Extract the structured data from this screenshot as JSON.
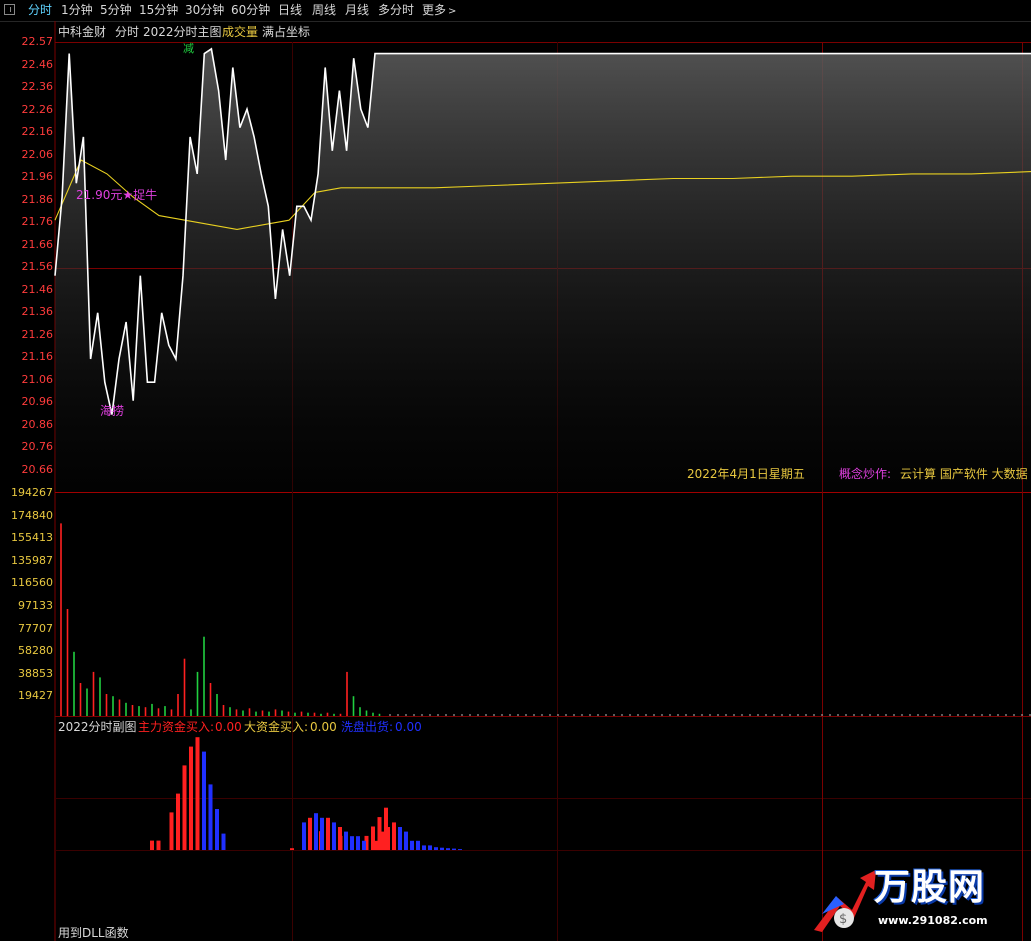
{
  "tabs": [
    "分时",
    "1分钟",
    "5分钟",
    "15分钟",
    "30分钟",
    "60分钟",
    "日线",
    "周线",
    "月线",
    "多分时",
    "更多"
  ],
  "header": {
    "stock_name": "中科金财",
    "mode": "分时",
    "formula": "2022分时主图",
    "volume_label": "成交量",
    "coord_mode": "满占坐标"
  },
  "price_axis": [
    "22.57",
    "22.46",
    "22.36",
    "22.26",
    "22.16",
    "22.06",
    "21.96",
    "21.86",
    "21.76",
    "21.66",
    "21.56",
    "21.46",
    "21.36",
    "21.26",
    "21.16",
    "21.06",
    "20.96",
    "20.86",
    "20.76",
    "20.66"
  ],
  "volume_axis": [
    "194267",
    "174840",
    "155413",
    "135987",
    "116560",
    "97133",
    "77707",
    "58280",
    "38853",
    "19427"
  ],
  "annotations": {
    "sell_marker": "减",
    "buy_marker": "海捞",
    "price_tag": "21.90元★捉牛"
  },
  "info_bar": {
    "date": "2022年4月1日星期五",
    "concept_label": "概念炒作:",
    "concepts": "云计算 国产软件 大数据 数"
  },
  "sub_panel": {
    "title": "2022分时副图",
    "main_inflow_label": "主力资金买入:",
    "main_inflow_value": "0.00",
    "big_inflow_label": "大资金买入:",
    "big_inflow_value": "0.00",
    "wash_label": "洗盘出货:",
    "wash_value": "0.00"
  },
  "footer": {
    "dll_notice": "用到DLL函数"
  },
  "watermark": {
    "brand": "万股网",
    "url": "www.291082.com"
  },
  "colors": {
    "price_line": "#ffffff",
    "avg_line": "#e8d020",
    "grid": "#7a0000",
    "up": "#ff2020",
    "down": "#20d040",
    "blue": "#2030ff",
    "magenta": "#e040e0",
    "active_tab": "#5fd3ff"
  },
  "chart_data": [
    {
      "type": "line",
      "title": "中科金财 分时",
      "ylim": [
        20.66,
        22.57
      ],
      "series": [
        {
          "name": "price",
          "values": [
            21.56,
            21.9,
            22.52,
            21.96,
            22.16,
            21.2,
            21.4,
            21.1,
            20.96,
            21.2,
            21.36,
            21.02,
            21.56,
            21.1,
            21.1,
            21.4,
            21.26,
            21.2,
            21.56,
            22.16,
            22.0,
            22.52,
            22.54,
            22.36,
            22.06,
            22.46,
            22.2,
            22.28,
            22.16,
            22.0,
            21.86,
            21.46,
            21.76,
            21.56,
            21.86,
            21.86,
            21.8,
            22.0,
            22.46,
            22.1,
            22.36,
            22.1,
            22.5,
            22.28,
            22.2,
            22.52,
            22.52
          ]
        },
        {
          "name": "avg",
          "values": [
            21.8,
            22.06,
            22.0,
            21.9,
            21.82,
            21.8,
            21.78,
            21.76,
            21.78,
            21.8,
            21.92,
            21.94,
            21.94,
            21.94,
            21.95,
            21.96,
            21.97,
            21.98,
            21.98,
            21.99,
            21.99,
            22.0,
            22.0,
            22.01
          ]
        }
      ]
    },
    {
      "type": "bar",
      "title": "成交量",
      "ylim": [
        0,
        194267
      ],
      "values": [
        174840,
        97133,
        58280,
        30000,
        25000,
        40000,
        35000,
        20000,
        18000,
        15000,
        12000,
        10000,
        9000,
        8000,
        11000,
        7000,
        9000,
        6000,
        20000,
        52000,
        6000,
        40000,
        72000,
        30000,
        20000,
        10000,
        8000,
        6000,
        5000,
        7000,
        4000,
        5000,
        4000,
        6000,
        5000,
        4000,
        3000,
        4000,
        3000,
        3000,
        2000,
        3000,
        2000,
        2000,
        40000,
        18000,
        8000,
        5000,
        3000,
        2000
      ],
      "colors": [
        "up",
        "up",
        "down",
        "up",
        "down",
        "up",
        "down",
        "up",
        "down",
        "up",
        "down",
        "up",
        "down",
        "up",
        "down",
        "up",
        "down",
        "up",
        "up",
        "up",
        "down",
        "down",
        "down",
        "up",
        "down",
        "up",
        "down",
        "up",
        "down",
        "up",
        "down",
        "up",
        "down",
        "up",
        "down",
        "up",
        "down",
        "up",
        "down",
        "up",
        "down",
        "up",
        "down",
        "up",
        "up",
        "down",
        "down",
        "down",
        "down",
        "down"
      ]
    },
    {
      "type": "bar",
      "title": "2022分时副图",
      "series": [
        {
          "name": "主力资金买入",
          "values": [
            2,
            2,
            0,
            8,
            12,
            18,
            22,
            24,
            0,
            0,
            0,
            0,
            0,
            0,
            0,
            0,
            0,
            0,
            0,
            0,
            0,
            0,
            0,
            0,
            0,
            0,
            4,
            0,
            5,
            3,
            0,
            0,
            0,
            3,
            5,
            7,
            9,
            0,
            0,
            0,
            0,
            0,
            0,
            0,
            0,
            0,
            0,
            0
          ]
        },
        {
          "name": "洗盘出货",
          "values": [
            0,
            0,
            0,
            0,
            0,
            0,
            0,
            0,
            24,
            16,
            10,
            4,
            0,
            0,
            0,
            0,
            0,
            0,
            0,
            0,
            0,
            0,
            0,
            0,
            0,
            0,
            0,
            0,
            0,
            0,
            0,
            0,
            0,
            0,
            0,
            0,
            0,
            0,
            0,
            0,
            0,
            0,
            0,
            0,
            0,
            0,
            0,
            0
          ]
        }
      ]
    }
  ]
}
